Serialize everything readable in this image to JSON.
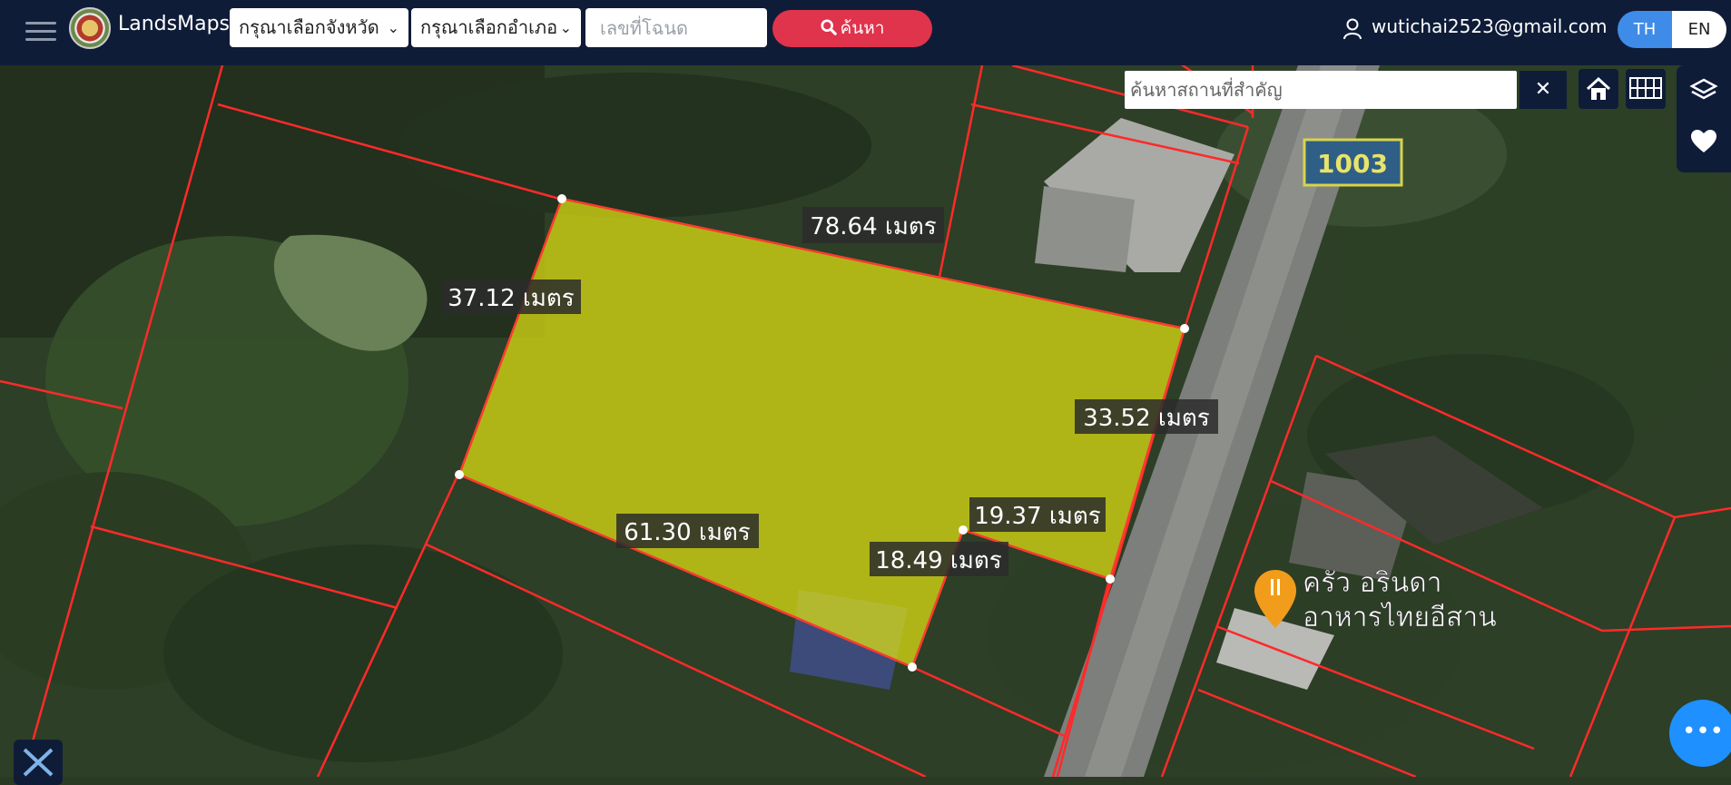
{
  "header": {
    "brand": "LandsMaps",
    "province_select": "กรุณาเลือกจังหวัด",
    "district_select": "กรุณาเลือกอำเภอ",
    "deed_placeholder": "เลขที่โฉนด",
    "search_label": "ค้นหา",
    "user_email": "wutichai2523@gmail.com",
    "lang_th": "TH",
    "lang_en": "EN"
  },
  "map": {
    "place_search_placeholder": "ค้นหาสถานที่สำคัญ",
    "close_symbol": "✕",
    "road_shield": "1003",
    "poi_line1": "ครัว อรินดา",
    "poi_line2": "อาหารไทยอีสาน",
    "measurements": {
      "top": "78.64 เมตร",
      "left": "37.12 เมตร",
      "right": "33.52 เมตร",
      "bottom_left": "61.30 เมตร",
      "notch_top": "19.37 เมตร",
      "notch_side": "18.49 เมตร"
    },
    "parcel_color": "#e2e312",
    "boundary_color": "#ff2a2a"
  },
  "icons": {
    "menu": "hamburger-icon",
    "search": "search-icon",
    "user": "user-icon",
    "home": "home-icon",
    "grid": "grid-icon",
    "layers": "layers-icon",
    "favorite": "heart-icon",
    "more": "ellipsis-icon",
    "ruler": "ruler-icon",
    "poi": "restaurant-pin-icon"
  },
  "fab_symbol": "•••"
}
